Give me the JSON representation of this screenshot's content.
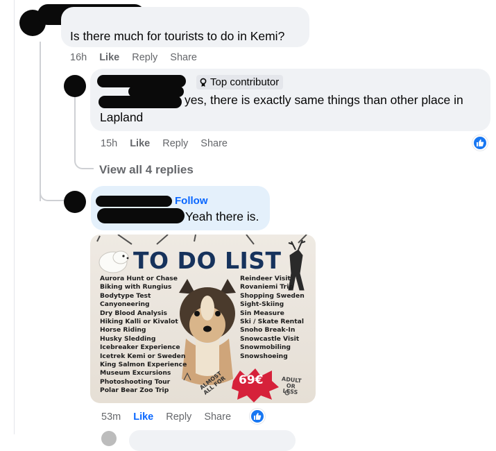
{
  "comments": [
    {
      "text": "Is there much for tourists to do in Kemi?",
      "time": "16h",
      "like_label": "Like",
      "reply_label": "Reply",
      "share_label": "Share"
    },
    {
      "badge": "Top contributor",
      "text_line1": "yes, there is exactly same things than other place in",
      "text_line2": "Lapland",
      "time": "15h",
      "like_label": "Like",
      "reply_label": "Reply",
      "share_label": "Share",
      "reaction_icon": "like-reaction-icon",
      "view_replies": "View all 4 replies"
    },
    {
      "follow_label": "Follow",
      "text": "Yeah there is.",
      "time": "53m",
      "like_label": "Like",
      "reply_label": "Reply",
      "share_label": "Share",
      "reaction_icon": "like-reaction-icon",
      "liked": true
    }
  ],
  "poster": {
    "title": "TO DO LIST",
    "left_items": [
      "Aurora Hunt or Chase",
      "Biking with Rungius",
      "Bodytype Test",
      "Canyoneering",
      "Dry Blood Analysis",
      "Hiking Kalli or Kivalot",
      "Horse Riding",
      "Husky Sledding",
      "Icebreaker Experience",
      "Icetrek Kemi or Sweden",
      "King Salmon Experience",
      "Museum Excursions",
      "Photoshooting Tour",
      "Polar Bear Zoo Trip"
    ],
    "right_items": [
      "Reindeer Visit",
      "Rovaniemi Trip",
      "Shopping Sweden",
      "Sight-Skiing",
      "Sin Measure",
      "Ski / Skate Rental",
      "Snoho Break-In",
      "Snowcastle Visit",
      "Snowmobiling",
      "Snowshoeing"
    ],
    "almost_all_for": [
      "ALMOST",
      "ALL FOR"
    ],
    "price": "69€",
    "adult_or_less": [
      "ADULT",
      "OR",
      "LESS"
    ]
  },
  "colors": {
    "bubble": "#f0f2f5",
    "bubble_highlight": "#e4f0fb",
    "link_blue": "#0866ff",
    "muted": "#65676b",
    "poster_title": "#16325c",
    "price_red": "#d6213a"
  }
}
